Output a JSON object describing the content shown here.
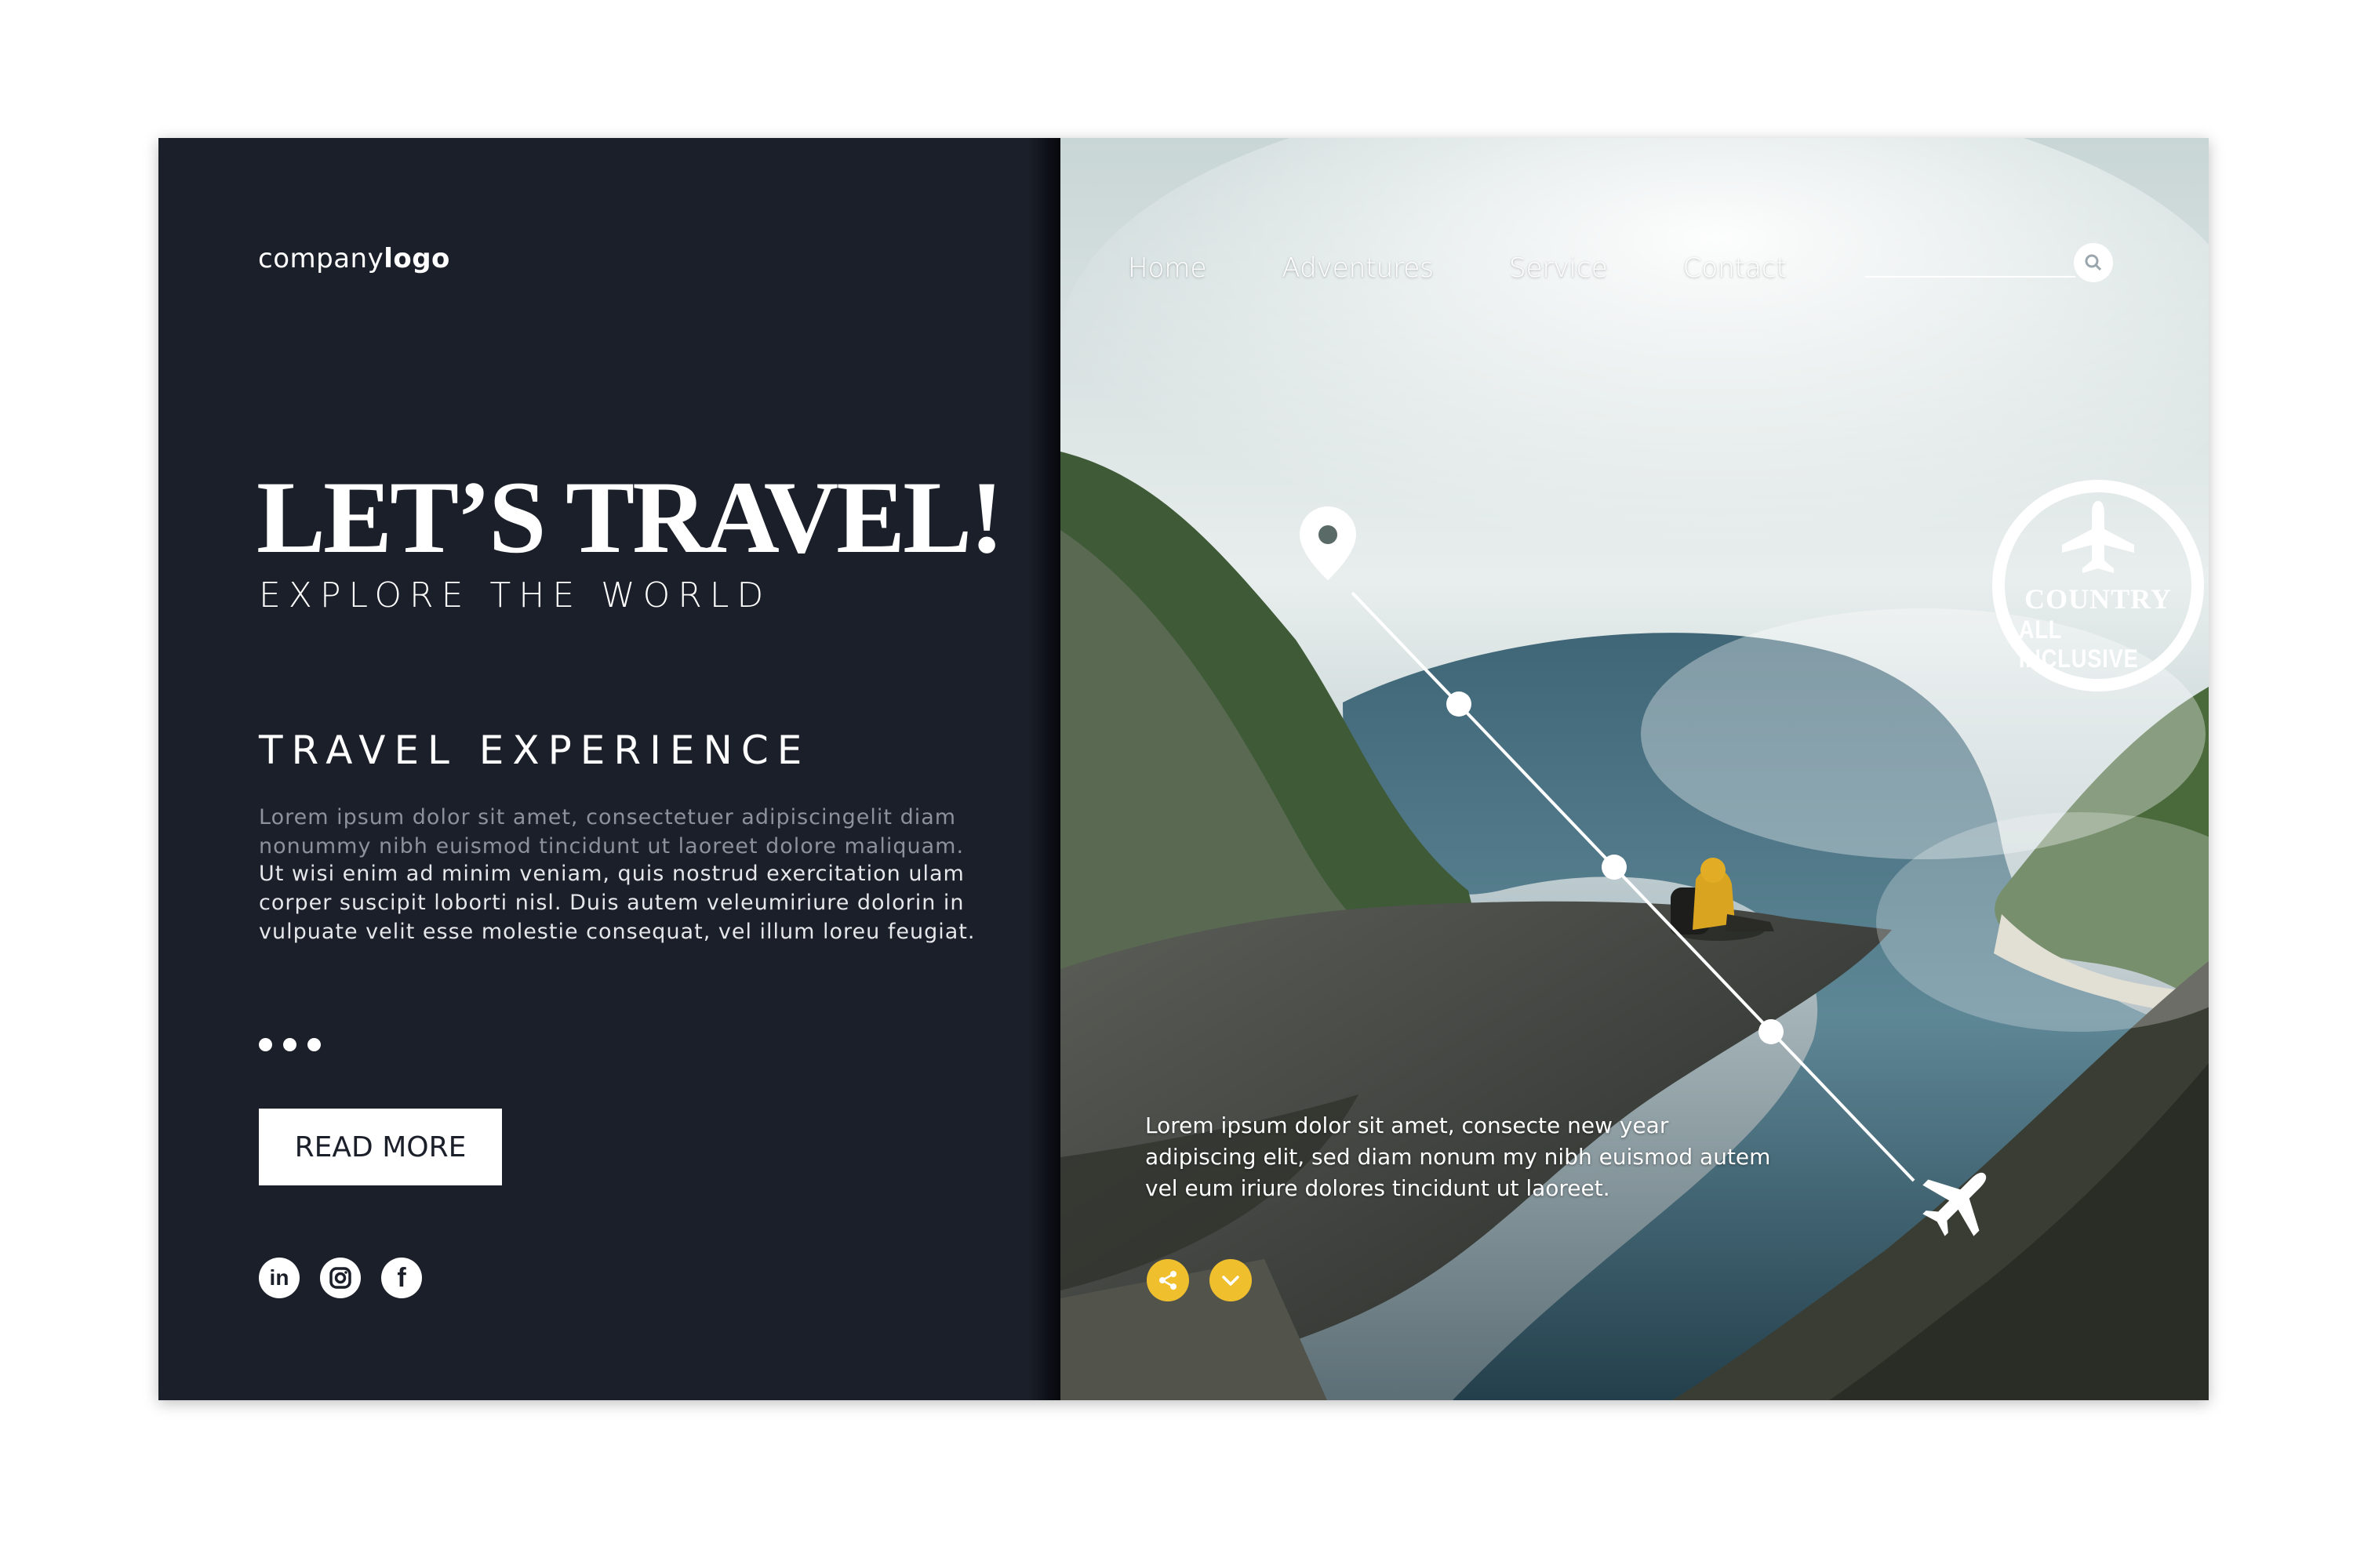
{
  "brand": {
    "logo_prefix": "company",
    "logo_bold": "logo"
  },
  "hero": {
    "headline": "LET’S TRAVEL!",
    "subheadline": "EXPLORE THE WORLD"
  },
  "section": {
    "title": "TRAVEL EXPERIENCE",
    "paragraph1": "Lorem ipsum dolor sit amet, consectetuer adipiscingelit diam nonummy nibh euismod tincidunt ut laoreet dolore maliquam.",
    "paragraph2": "Ut wisi enim ad minim veniam, quis nostrud exercitation ulam corper suscipit loborti nisl. Duis autem veleumiriure dolorin in vulpuate velit esse molestie consequat, vel illum loreu feugiat.",
    "button_label": "READ MORE"
  },
  "social": {
    "linkedin": "in",
    "instagram": "instagram-icon",
    "facebook": "f"
  },
  "nav": {
    "items": [
      "Home",
      "Adventures",
      "Service",
      "Contact"
    ]
  },
  "badge": {
    "title": "COUNTRY",
    "subtitle": "ALL INCLUSIVE"
  },
  "caption": "Lorem ipsum dolor sit amet, consecte new year adipiscing elit, sed diam nonum my nibh euismod autem vel eum iriure dolores tincidunt ut laoreet.",
  "colors": {
    "panel": "#1b1f29",
    "accent": "#f0bf2e",
    "white": "#ffffff"
  },
  "icons": [
    "map-pin-icon",
    "airplane-icon",
    "search-icon",
    "share-icon",
    "chevron-down-icon",
    "linkedin-icon",
    "instagram-icon",
    "facebook-icon"
  ]
}
